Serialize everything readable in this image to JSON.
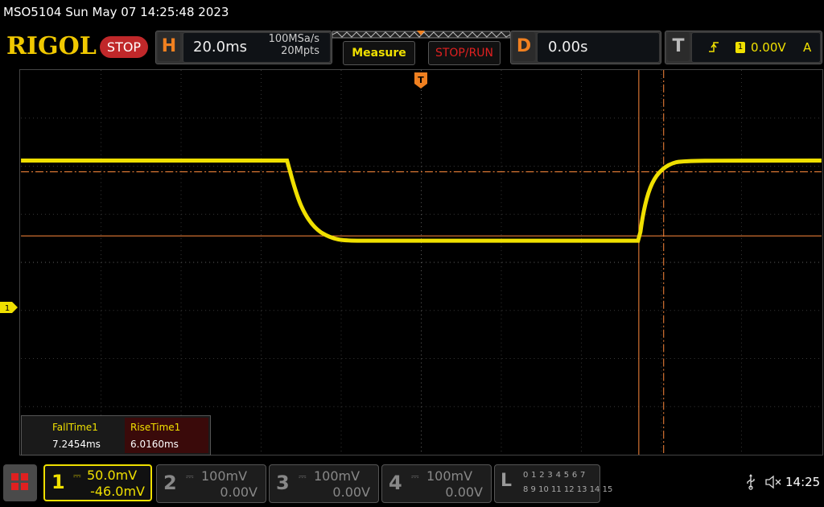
{
  "title": "MSO5104  Sun May 07 14:25:48 2023",
  "header": {
    "logo": "RIGOL",
    "run_state": "STOP",
    "horizontal": {
      "letter": "H",
      "timebase": "20.0ms",
      "sample_rate": "100MSa/s",
      "memory_depth": "20Mpts"
    },
    "measure_label": "Measure",
    "stoprun_label": "STOP/RUN",
    "delay": {
      "letter": "D",
      "value": "0.00s"
    },
    "trigger": {
      "letter": "T",
      "slope_icon": "rising-edge-icon",
      "source": "1",
      "level": "0.00V",
      "mode": "A"
    }
  },
  "screen": {
    "trigger_position_label": "T",
    "ch1_ground_marker": "1"
  },
  "measurements": [
    {
      "name": "FallTime1",
      "value": "7.2454ms"
    },
    {
      "name": "RiseTime1",
      "value": "6.0160ms"
    }
  ],
  "channels": [
    {
      "number": "1",
      "scale": "50.0mV",
      "offset": "-46.0mV",
      "active": true
    },
    {
      "number": "2",
      "scale": "100mV",
      "offset": "0.00V",
      "active": false
    },
    {
      "number": "3",
      "scale": "100mV",
      "offset": "0.00V",
      "active": false
    },
    {
      "number": "4",
      "scale": "100mV",
      "offset": "0.00V",
      "active": false
    }
  ],
  "logic": {
    "letter": "L",
    "row1": "0 1 2 3   4 5 6 7",
    "row2": "8 9 10 11  12 13 14 15"
  },
  "status": {
    "time": "14:25"
  },
  "colors": {
    "ch1": "#f0e000",
    "accent": "#f08020",
    "stop": "#c0282a",
    "cursor": "#ff8a3c"
  }
}
